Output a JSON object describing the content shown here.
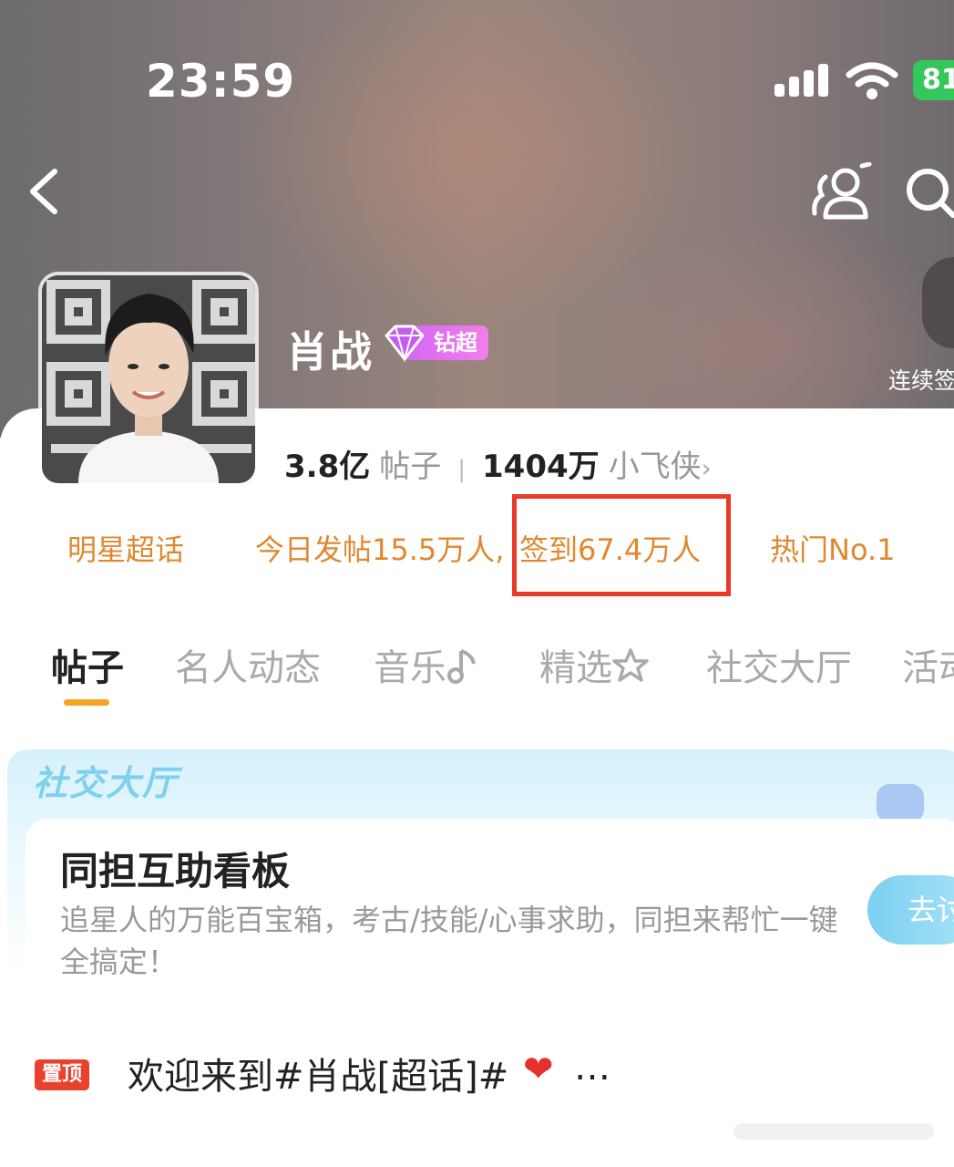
{
  "status_bar": {
    "time": "23:59",
    "battery": "81"
  },
  "profile": {
    "name": "肖战",
    "badge_label": "钻超",
    "side_label": "连续签",
    "stats": [
      {
        "value": "3.8亿",
        "label": "帖子"
      },
      {
        "value": "1404万",
        "label": "小飞侠"
      }
    ],
    "stats_arrow": "›"
  },
  "info_row": {
    "category": "明星超话",
    "today_posts": "今日发帖15.5万人,",
    "checkins": "签到67.4万人",
    "rank": "热门No.1"
  },
  "tabs": [
    {
      "label": "帖子",
      "active": true
    },
    {
      "label": "名人动态"
    },
    {
      "label": "音乐"
    },
    {
      "label": "精选"
    },
    {
      "label": "社交大厅"
    },
    {
      "label": "活动"
    }
  ],
  "social_hall": {
    "title": "社交大厅",
    "card_title": "同担互助看板",
    "card_desc": "追星人的万能百宝箱，考古/技能/心事求助，同担来帮忙一键全搞定！",
    "button": "去讨"
  },
  "pinned": {
    "badge": "置顶",
    "text": "欢迎来到#肖战[超话]#",
    "ellipsis": "…"
  },
  "colors": {
    "accent_orange": "#e0882f",
    "highlight_red": "#e83a26",
    "tab_underline": "#f4a623",
    "pin_red": "#e8412d"
  }
}
